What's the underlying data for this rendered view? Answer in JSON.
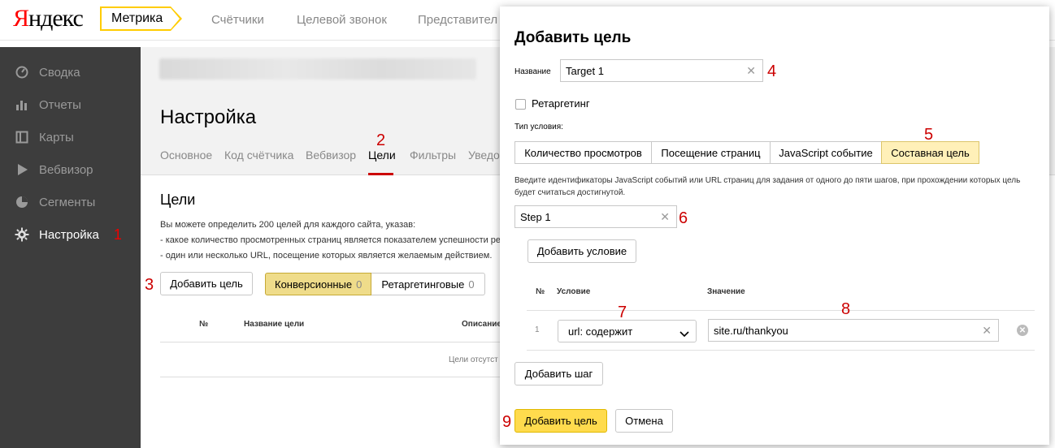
{
  "header": {
    "logo_first": "Я",
    "logo_rest": "ндекс",
    "product": "Метрика",
    "nav": [
      "Счётчики",
      "Целевой звонок",
      "Представител"
    ]
  },
  "sidebar": {
    "items": [
      {
        "label": "Сводка",
        "icon": "dashboard-icon"
      },
      {
        "label": "Отчеты",
        "icon": "bar-chart-icon"
      },
      {
        "label": "Карты",
        "icon": "map-icon"
      },
      {
        "label": "Вебвизор",
        "icon": "play-icon"
      },
      {
        "label": "Сегменты",
        "icon": "pie-icon"
      },
      {
        "label": "Настройка",
        "icon": "gear-icon",
        "marker": "1"
      }
    ]
  },
  "settings": {
    "title": "Настройка",
    "tabs": [
      "Основное",
      "Код счётчика",
      "Вебвизор",
      "Цели",
      "Фильтры",
      "Уведо"
    ],
    "active_tab_marker": "2"
  },
  "goals": {
    "title": "Цели",
    "desc_line1": "Вы можете определить 200 целей для каждого сайта, указав:",
    "desc_line2": "-  какое количество просмотренных страниц является показателем успешности рекл",
    "desc_line3": "-  один или несколько URL, посещение которых является желаемым действием.",
    "add_button": "Добавить цель",
    "add_marker": "3",
    "filter_conv": "Конверсионные",
    "filter_conv_count": "0",
    "filter_retarget": "Ретаргетинговые",
    "filter_retarget_count": "0",
    "table_headers": [
      "№",
      "Название цели",
      "Описание"
    ],
    "empty_text": "Цели отсутст"
  },
  "modal": {
    "title": "Добавить цель",
    "name_label": "Название",
    "name_value": "Target 1",
    "name_marker": "4",
    "retarget_label": "Ретаргетинг",
    "type_label": "Тип условия:",
    "types": [
      "Количество просмотров",
      "Посещение страниц",
      "JavaScript событие",
      "Составная цель"
    ],
    "selected_type": "Составная цель",
    "type_marker": "5",
    "description": "Введите идентификаторы JavaScript событий или URL страниц для задания от одного до пяти шагов, при прохождении которых цель будет считаться достигнутой.",
    "step_value": "Step 1",
    "step_marker": "6",
    "add_condition": "Добавить условие",
    "cond_headers": [
      "№",
      "Условие",
      "Значение"
    ],
    "cond_row_num": "1",
    "cond_select": "url: содержит",
    "cond_select_marker": "7",
    "cond_value": "site.ru/thankyou",
    "cond_value_marker": "8",
    "add_step": "Добавить шаг",
    "submit": "Добавить цель",
    "submit_marker": "9",
    "cancel": "Отмена"
  }
}
